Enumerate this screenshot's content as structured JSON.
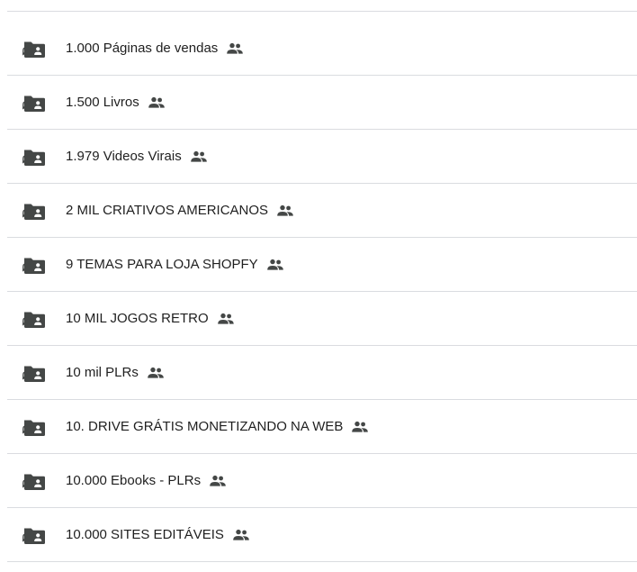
{
  "colors": {
    "text": "#1f1f1f",
    "icon": "#444746",
    "divider": "#dadce0"
  },
  "icons": {
    "item": "shared-folder-shortcut-icon",
    "shared": "people-icon"
  },
  "rows": [
    {
      "label": "1.000 Páginas de vendas"
    },
    {
      "label": "1.500 Livros"
    },
    {
      "label": "1.979 Videos Virais"
    },
    {
      "label": "2 MIL CRIATIVOS AMERICANOS"
    },
    {
      "label": "9 TEMAS PARA LOJA SHOPFY"
    },
    {
      "label": "10 MIL JOGOS RETRO"
    },
    {
      "label": "10 mil PLRs"
    },
    {
      "label": "10. DRIVE GRÁTIS MONETIZANDO NA WEB"
    },
    {
      "label": "10.000 Ebooks - PLRs"
    },
    {
      "label": "10.000 SITES EDITÁVEIS"
    }
  ]
}
